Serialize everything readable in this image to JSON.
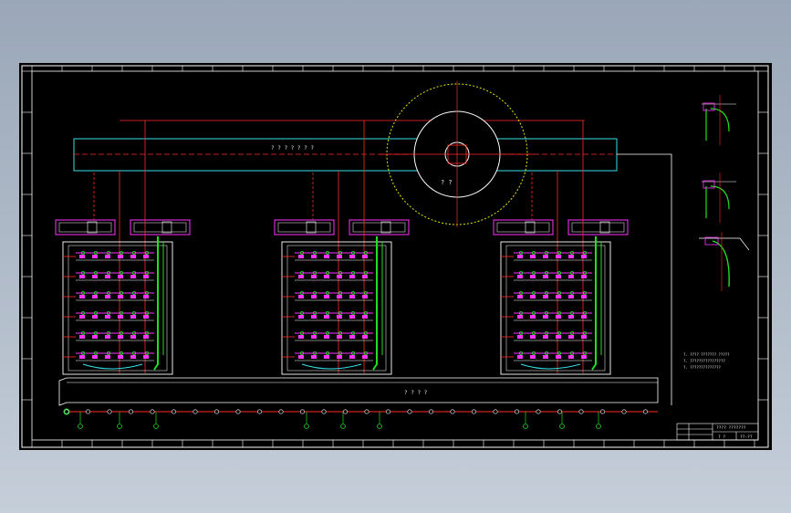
{
  "drawing": {
    "background": "#000000",
    "frame_color": "#ffffff",
    "colors": {
      "red": "#ff2a2a",
      "cyan": "#33e0e6",
      "green": "#1fe01f",
      "magenta": "#ff33ff",
      "yellow": "#e6e600",
      "white": "#ffffff"
    },
    "tank_label": "? ? ? ? ? ? ?",
    "circle_label": "? ?",
    "bottom_dim_label": "? ? ? ?",
    "notes": [
      "?. ???? ??????? ?????",
      "?. ????????????????",
      "?. ??????????????"
    ],
    "title_block": {
      "title": "???? ???????",
      "sheet_no": "? ?",
      "drawing_no": "??-??"
    }
  }
}
